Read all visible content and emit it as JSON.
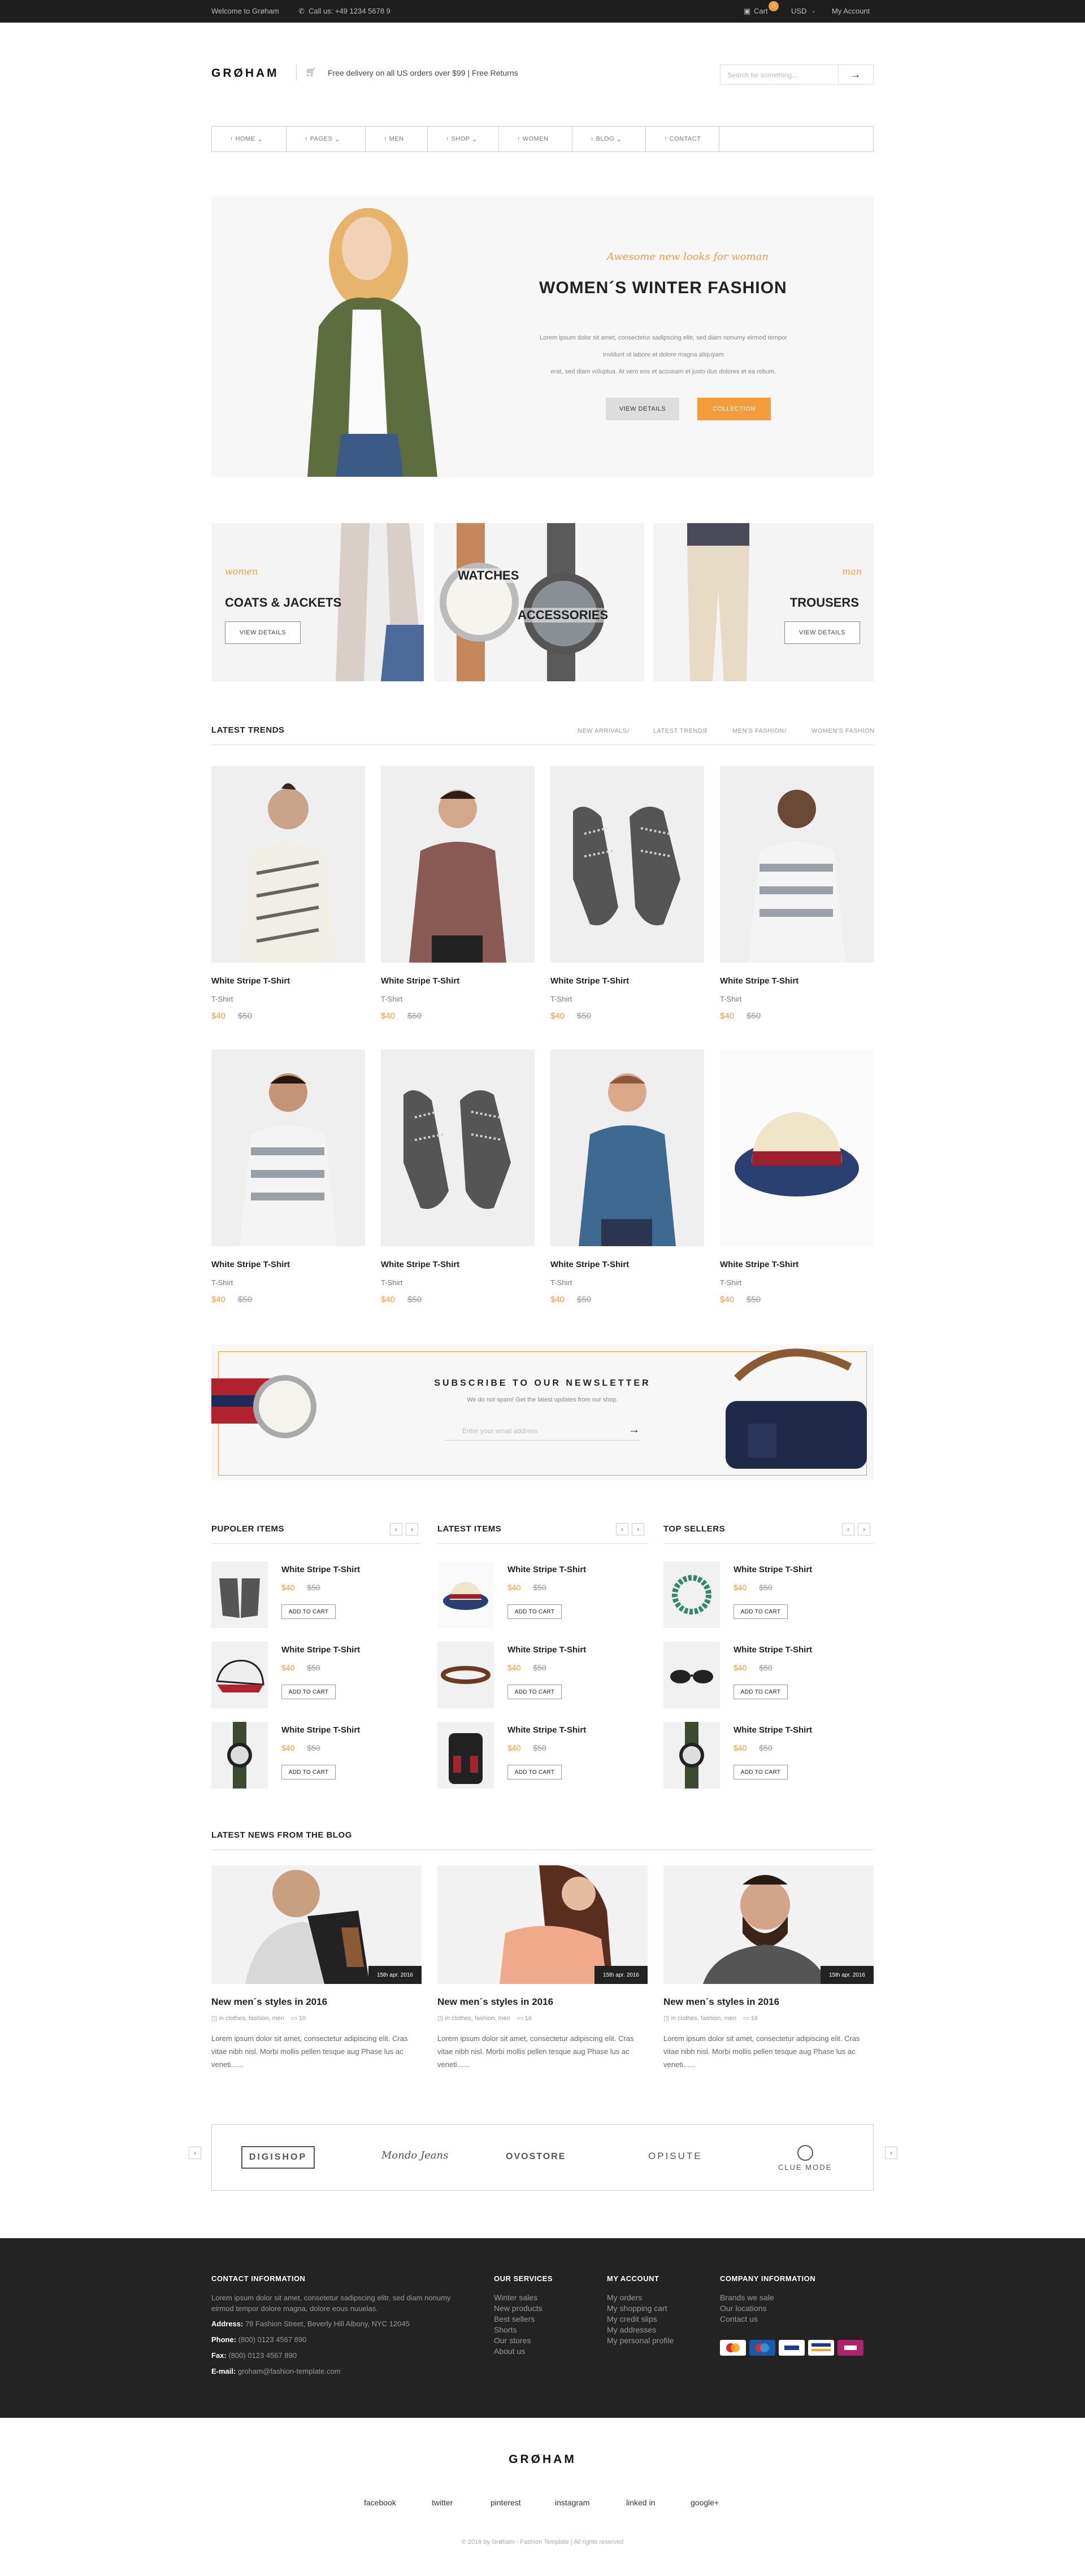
{
  "topbar": {
    "welcome": "Welcome to Grøham",
    "phone": "Call us: +49 1234 5678 9",
    "cart": "Cart",
    "cart_count": "0",
    "currency": "USD",
    "account": "My Account"
  },
  "header": {
    "logo": "GRØHAM",
    "shipping": "Free delivery on all US orders over $99 | Free Returns",
    "search_placeholder": "Search for something..."
  },
  "nav": [
    "HOME",
    "PAGES",
    "MEN",
    "SHOP",
    "WOMEN",
    "BLOG",
    "CONTACT"
  ],
  "hero": {
    "tagline": "Awesome new looks for woman",
    "title": "WOMEN´S WINTER FASHION",
    "text1": "Lorem ipsum dolor sit amet, consectetur sadipscing elitr, sed diam nonumy eirmod tempor",
    "text2": "invidunt ut labore et dolore magna aliquyam",
    "text3": "erat, sed diam voluptua. At vero eos et accusam et justo duo dolores et ea rebum.",
    "btn1": "VIEW DETAILS",
    "btn2": "COLLECTION"
  },
  "banners": {
    "b1_tag": "women",
    "b1_title": "COATS & JACKETS",
    "b1_btn": "VIEW DETAILS",
    "b2_title1": "WATCHES",
    "b2_title2": "ACCESSORIES",
    "b3_tag": "man",
    "b3_title": "TROUSERS",
    "b3_btn": "VIEW DETAILS"
  },
  "trends": {
    "title": "LATEST TRENDS",
    "filters": [
      "NEW ARRIVALS",
      "LATEST TRENDS",
      "MEN'S FASHION",
      "WOMEN'S FASHION"
    ],
    "products": [
      {
        "name": "White Stripe T-Shirt",
        "cat": "T-Shirt",
        "price": "$40",
        "old": "$50"
      },
      {
        "name": "White Stripe T-Shirt",
        "cat": "T-Shirt",
        "price": "$40",
        "old": "$50"
      },
      {
        "name": "White Stripe T-Shirt",
        "cat": "T-Shirt",
        "price": "$40",
        "old": "$50"
      },
      {
        "name": "White Stripe T-Shirt",
        "cat": "T-Shirt",
        "price": "$40",
        "old": "$50"
      },
      {
        "name": "White Stripe T-Shirt",
        "cat": "T-Shirt",
        "price": "$40",
        "old": "$50"
      },
      {
        "name": "White Stripe T-Shirt",
        "cat": "T-Shirt",
        "price": "$40",
        "old": "$50"
      },
      {
        "name": "White Stripe T-Shirt",
        "cat": "T-Shirt",
        "price": "$40",
        "old": "$50"
      },
      {
        "name": "White Stripe T-Shirt",
        "cat": "T-Shirt",
        "price": "$40",
        "old": "$50"
      }
    ]
  },
  "newsletter": {
    "title": "SUBSCRIBE TO OUR NEWSLETTER",
    "sub": "We do not spam! Get the latest updates from our shop.",
    "placeholder": "Enter your email address"
  },
  "lists": [
    {
      "title": "PUPOLER ITEMS",
      "items": [
        {
          "name": "White Stripe T-Shirt",
          "price": "$40",
          "old": "$50",
          "btn": "ADD TO CART"
        },
        {
          "name": "White Stripe T-Shirt",
          "price": "$40",
          "old": "$50",
          "btn": "ADD TO CART"
        },
        {
          "name": "White Stripe T-Shirt",
          "price": "$40",
          "old": "$50",
          "btn": "ADD TO CART"
        }
      ]
    },
    {
      "title": "LATEST ITEMS",
      "items": [
        {
          "name": "White Stripe T-Shirt",
          "price": "$40",
          "old": "$50",
          "btn": "ADD TO CART"
        },
        {
          "name": "White Stripe T-Shirt",
          "price": "$40",
          "old": "$50",
          "btn": "ADD TO CART"
        },
        {
          "name": "White Stripe T-Shirt",
          "price": "$40",
          "old": "$50",
          "btn": "ADD TO CART"
        }
      ]
    },
    {
      "title": "TOP SELLERS",
      "items": [
        {
          "name": "White Stripe T-Shirt",
          "price": "$40",
          "old": "$50",
          "btn": "ADD TO CART"
        },
        {
          "name": "White Stripe T-Shirt",
          "price": "$40",
          "old": "$50",
          "btn": "ADD TO CART"
        },
        {
          "name": "White Stripe T-Shirt",
          "price": "$40",
          "old": "$50",
          "btn": "ADD TO CART"
        }
      ]
    }
  ],
  "blog": {
    "title": "LATEST NEWS FROM THE BLOG",
    "posts": [
      {
        "date": "15th apr. 2016",
        "title": "New men´s styles in 2016",
        "tags": "in clothes, fashion, men",
        "comments": "16",
        "excerpt": "Lorem ipsum dolor sit amet, consectetur adipiscing elit. Cras vitae nibh nisl. Morbi mollis pellen tesque aug Phase lus ac veneti......"
      },
      {
        "date": "15th apr. 2016",
        "title": "New men´s styles in 2016",
        "tags": "in clothes, fashion, men",
        "comments": "16",
        "excerpt": "Lorem ipsum dolor sit amet, consectetur adipiscing elit. Cras vitae nibh nisl. Morbi mollis pellen tesque aug Phase lus ac veneti......"
      },
      {
        "date": "15th apr. 2016",
        "title": "New men´s styles in 2016",
        "tags": "in clothes, fashion, men",
        "comments": "16",
        "excerpt": "Lorem ipsum dolor sit amet, consectetur adipiscing elit. Cras vitae nibh nisl. Morbi mollis pellen tesque aug Phase lus ac veneti......"
      }
    ]
  },
  "brands": [
    "DIGISHOP",
    "Mondo Jeans",
    "OVOSTORE",
    "OPISUTE",
    "CLUE MODE"
  ],
  "footer": {
    "contact_title": "CONTACT INFORMATION",
    "contact_text": "Lorem ipsum dolor sit amet, consetetur sadipscing elitr, sed diam nonumy eirmod tempor dolore magna, dolore eous nuuelas.",
    "address_label": "Address:",
    "address": "78 Fashion Street, Beverly Hill Albony, NYC 12045",
    "phone_label": "Phone:",
    "phone": "(800) 0123 4567 890",
    "fax_label": "Fax:",
    "fax": "(800) 0123 4567 890",
    "email_label": "E-mail:",
    "email": "groham@fashion-template.com",
    "services_title": "OUR SERVICES",
    "services": [
      "Winter sales",
      "New products",
      "Best sellers",
      "Shorts",
      "Our stores",
      "About us"
    ],
    "account_title": "MY ACCOUNT",
    "account": [
      "My orders",
      "My shopping cart",
      "My credit slips",
      "My addresses",
      "My personal profile"
    ],
    "company_title": "COMPANY INFORMATION",
    "company": [
      "Brands we sale",
      "Our locations",
      "Contact us"
    ]
  },
  "bottom": {
    "logo": "GRØHAM",
    "social": [
      "facebook",
      "twitter",
      "pinterest",
      "instagram",
      "linked in",
      "google+"
    ],
    "copyright": "© 2016 by Grøham - Fashion Template | All rights reserved"
  },
  "colors": {
    "accent": "#f39c3c",
    "dark": "#232323"
  }
}
